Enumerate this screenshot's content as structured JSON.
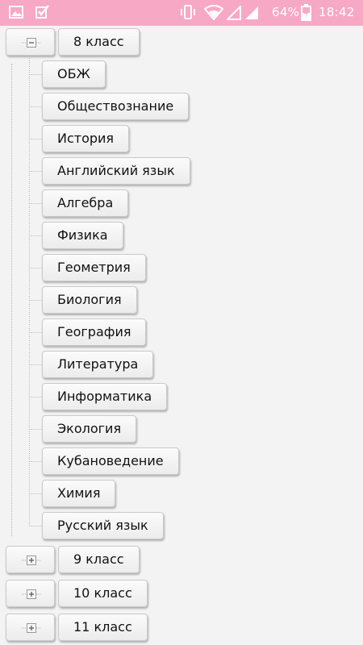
{
  "status_bar": {
    "battery_percent": "64%",
    "time": "18:42",
    "background": "#f7a8c4"
  },
  "tree": {
    "expanded": {
      "label": "8 класс",
      "toggle_icon": "minus-square-icon",
      "children": [
        "ОБЖ",
        "Обществознание",
        "История",
        "Английский язык",
        "Алгебра",
        "Физика",
        "Геометрия",
        "Биология",
        "География",
        "Литература",
        "Информатика",
        "Экология",
        "Кубановедение",
        "Химия",
        "Русский язык"
      ]
    },
    "collapsed": [
      {
        "label": "9 класс",
        "toggle_icon": "plus-square-icon"
      },
      {
        "label": "10 класс",
        "toggle_icon": "plus-square-icon"
      },
      {
        "label": "11 класс",
        "toggle_icon": "plus-square-icon"
      }
    ]
  }
}
